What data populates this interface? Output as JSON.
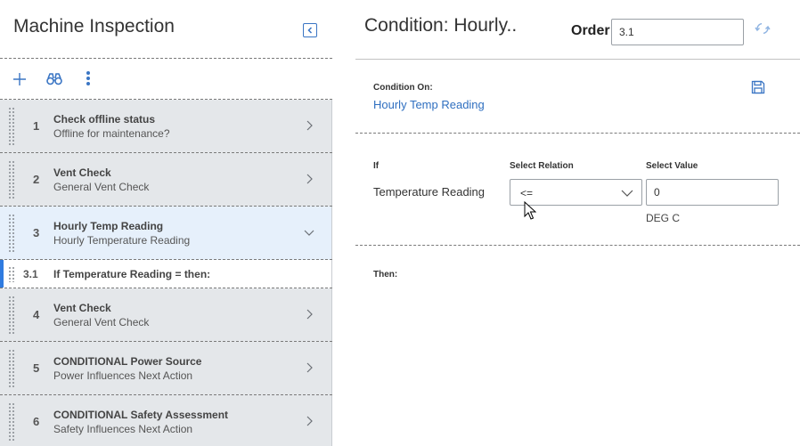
{
  "left_panel": {
    "title": "Machine Inspection",
    "toolbar_icons": [
      "add-icon",
      "binoculars-icon",
      "more-vertical-icon"
    ],
    "steps": [
      {
        "num": "1",
        "title": "Check offline status",
        "subtitle": "Offline for maintenance?",
        "expanded": false
      },
      {
        "num": "2",
        "title": "Vent Check",
        "subtitle": "General Vent Check",
        "expanded": false
      },
      {
        "num": "3",
        "title": "Hourly Temp Reading",
        "subtitle": "Hourly Temperature Reading",
        "expanded": true
      },
      {
        "num": "4",
        "title": "Vent Check",
        "subtitle": "General Vent Check",
        "expanded": false
      },
      {
        "num": "5",
        "title": "CONDITIONAL Power Source",
        "subtitle": "Power Influences Next Action",
        "expanded": false
      },
      {
        "num": "6",
        "title": "CONDITIONAL Safety Assessment",
        "subtitle": "Safety Influences Next Action",
        "expanded": false
      }
    ],
    "substep": {
      "num": "3.1",
      "title": "If Temperature Reading = then:"
    }
  },
  "right_panel": {
    "title": "Condition: Hourly..",
    "order_label": "Order",
    "order_value": "3.1",
    "condition_on_label": "Condition On:",
    "condition_on_value": "Hourly Temp Reading",
    "if_label": "If",
    "select_relation_label": "Select Relation",
    "select_value_label": "Select Value",
    "if_field": "Temperature Reading",
    "relation_value": "<=",
    "value": "0",
    "unit": "DEG C",
    "then_label": "Then:"
  },
  "colors": {
    "accent": "#2f7be0",
    "link": "#2f6fc0",
    "step_bg": "#e4e7ea",
    "active_step_bg": "#e6f0fb"
  }
}
